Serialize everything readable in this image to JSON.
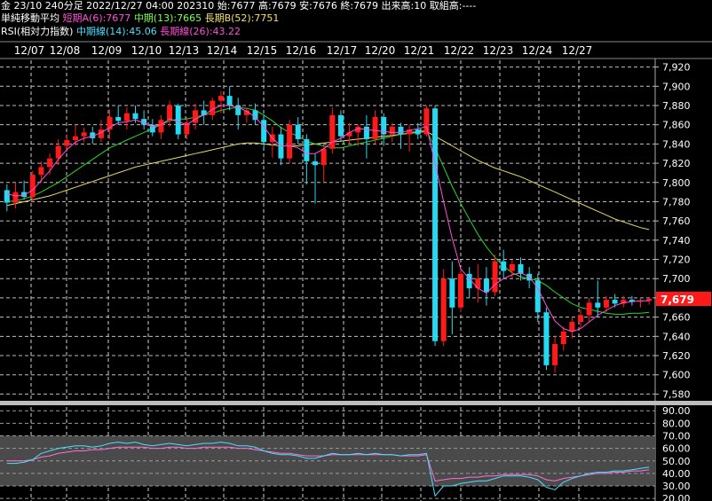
{
  "header": {
    "line1": "金 23/10 240分足 2022/12/27 04:00 202310 始:7677 高:7679 安:7676 終:7679 出来高:10 取組高:----",
    "line2_title": "単純移動平均",
    "line2_a": "短期A(6):7677",
    "line2_b": "中期(13):7665",
    "line2_c": "長期B(52):7751",
    "line3_title": "RSI(相対力指数)",
    "line3_a": "中期線(14):45.06",
    "line3_b": "長期線(26):43.22"
  },
  "colors": {
    "up": "#ff1a1a",
    "down": "#26d9f2",
    "ma_short": "#ff4fd8",
    "ma_mid": "#2bd52b",
    "ma_long": "#e8d86a",
    "rsi_mid": "#48e0ff",
    "rsi_long": "#ff6fd8",
    "price_badge": "#ff1a1a",
    "rsi_band": "#4a4a4a"
  },
  "chart_data": [
    {
      "type": "candlestick",
      "x_labels": [
        "12/07",
        "12/08",
        "12/09",
        "12/10",
        "12/13",
        "12/14",
        "12/15",
        "12/16",
        "12/17",
        "12/20",
        "12/21",
        "12/22",
        "12/23",
        "12/24",
        "12/27"
      ],
      "y_ticks": [
        7580,
        7600,
        7620,
        7640,
        7660,
        7680,
        7700,
        7720,
        7740,
        7760,
        7780,
        7800,
        7820,
        7840,
        7860,
        7880,
        7900,
        7920
      ],
      "ylim": [
        7573,
        7927
      ],
      "current_price": "7,679",
      "candles": [
        [
          7792,
          7798,
          7770,
          7779
        ],
        [
          7779,
          7800,
          7773,
          7790
        ],
        [
          7790,
          7802,
          7782,
          7785
        ],
        [
          7785,
          7812,
          7780,
          7808
        ],
        [
          7808,
          7822,
          7800,
          7816
        ],
        [
          7816,
          7830,
          7808,
          7825
        ],
        [
          7825,
          7845,
          7818,
          7838
        ],
        [
          7838,
          7850,
          7832,
          7844
        ],
        [
          7844,
          7860,
          7838,
          7848
        ],
        [
          7848,
          7857,
          7842,
          7852
        ],
        [
          7852,
          7858,
          7840,
          7846
        ],
        [
          7846,
          7865,
          7842,
          7855
        ],
        [
          7855,
          7876,
          7845,
          7868
        ],
        [
          7868,
          7880,
          7860,
          7864
        ],
        [
          7864,
          7878,
          7855,
          7872
        ],
        [
          7872,
          7880,
          7862,
          7866
        ],
        [
          7866,
          7875,
          7855,
          7860
        ],
        [
          7860,
          7866,
          7848,
          7852
        ],
        [
          7852,
          7870,
          7845,
          7865
        ],
        [
          7865,
          7885,
          7858,
          7880
        ],
        [
          7880,
          7882,
          7845,
          7850
        ],
        [
          7850,
          7868,
          7845,
          7862
        ],
        [
          7862,
          7882,
          7855,
          7875
        ],
        [
          7875,
          7885,
          7860,
          7870
        ],
        [
          7870,
          7888,
          7865,
          7885
        ],
        [
          7885,
          7895,
          7872,
          7890
        ],
        [
          7890,
          7900,
          7875,
          7880
        ],
        [
          7880,
          7888,
          7855,
          7870
        ],
        [
          7870,
          7878,
          7862,
          7875
        ],
        [
          7875,
          7882,
          7860,
          7865
        ],
        [
          7865,
          7870,
          7835,
          7842
        ],
        [
          7842,
          7858,
          7826,
          7850
        ],
        [
          7850,
          7858,
          7818,
          7825
        ],
        [
          7825,
          7865,
          7820,
          7860
        ],
        [
          7860,
          7868,
          7840,
          7845
        ],
        [
          7845,
          7850,
          7798,
          7822
        ],
        [
          7822,
          7830,
          7778,
          7818
        ],
        [
          7818,
          7840,
          7800,
          7835
        ],
        [
          7835,
          7878,
          7830,
          7870
        ],
        [
          7870,
          7875,
          7842,
          7848
        ],
        [
          7848,
          7862,
          7840,
          7852
        ],
        [
          7852,
          7860,
          7838,
          7858
        ],
        [
          7858,
          7870,
          7825,
          7845
        ],
        [
          7845,
          7875,
          7840,
          7868
        ],
        [
          7868,
          7872,
          7838,
          7850
        ],
        [
          7850,
          7862,
          7842,
          7858
        ],
        [
          7858,
          7862,
          7835,
          7850
        ],
        [
          7850,
          7860,
          7832,
          7855
        ],
        [
          7855,
          7862,
          7845,
          7850
        ],
        [
          7850,
          7880,
          7848,
          7877
        ],
        [
          7877,
          7880,
          7630,
          7635
        ],
        [
          7635,
          7710,
          7630,
          7700
        ],
        [
          7700,
          7718,
          7642,
          7670
        ],
        [
          7670,
          7712,
          7665,
          7705
        ],
        [
          7705,
          7712,
          7680,
          7690
        ],
        [
          7690,
          7715,
          7675,
          7700
        ],
        [
          7700,
          7712,
          7672,
          7686
        ],
        [
          7686,
          7725,
          7682,
          7718
        ],
        [
          7718,
          7730,
          7700,
          7708
        ],
        [
          7708,
          7720,
          7700,
          7715
        ],
        [
          7715,
          7722,
          7698,
          7705
        ],
        [
          7705,
          7712,
          7690,
          7698
        ],
        [
          7698,
          7705,
          7655,
          7665
        ],
        [
          7665,
          7670,
          7605,
          7610
        ],
        [
          7610,
          7640,
          7602,
          7632
        ],
        [
          7632,
          7650,
          7625,
          7645
        ],
        [
          7645,
          7660,
          7638,
          7655
        ],
        [
          7655,
          7668,
          7648,
          7662
        ],
        [
          7662,
          7680,
          7655,
          7675
        ],
        [
          7675,
          7698,
          7660,
          7670
        ],
        [
          7670,
          7682,
          7665,
          7678
        ],
        [
          7678,
          7684,
          7670,
          7674
        ],
        [
          7674,
          7682,
          7670,
          7678
        ],
        [
          7678,
          7682,
          7672,
          7676
        ],
        [
          7676,
          7680,
          7670,
          7677
        ],
        [
          7677,
          7681,
          7673,
          7679
        ]
      ],
      "ma_short": [
        7788,
        7786,
        7787,
        7792,
        7802,
        7812,
        7824,
        7834,
        7842,
        7846,
        7848,
        7852,
        7857,
        7862,
        7863,
        7865,
        7862,
        7858,
        7860,
        7866,
        7863,
        7860,
        7866,
        7870,
        7876,
        7880,
        7880,
        7878,
        7874,
        7868,
        7858,
        7846,
        7838,
        7838,
        7836,
        7830,
        7830,
        7835,
        7842,
        7846,
        7852,
        7856,
        7855,
        7854,
        7853,
        7852,
        7852,
        7854,
        7856,
        7858,
        7820,
        7780,
        7742,
        7710,
        7700,
        7690,
        7685,
        7694,
        7700,
        7704,
        7706,
        7702,
        7690,
        7672,
        7656,
        7648,
        7645,
        7648,
        7655,
        7662,
        7667,
        7672,
        7675,
        7676,
        7677,
        7677
      ],
      "ma_mid": [
        7780,
        7781,
        7783,
        7786,
        7790,
        7795,
        7800,
        7806,
        7812,
        7818,
        7824,
        7830,
        7836,
        7840,
        7844,
        7848,
        7852,
        7856,
        7860,
        7864,
        7866,
        7866,
        7868,
        7870,
        7872,
        7875,
        7877,
        7878,
        7877,
        7875,
        7870,
        7864,
        7857,
        7852,
        7848,
        7843,
        7840,
        7838,
        7836,
        7836,
        7838,
        7840,
        7842,
        7844,
        7846,
        7848,
        7850,
        7852,
        7853,
        7854,
        7836,
        7816,
        7796,
        7778,
        7762,
        7746,
        7733,
        7722,
        7713,
        7706,
        7702,
        7700,
        7698,
        7693,
        7686,
        7680,
        7674,
        7670,
        7668,
        7666,
        7664,
        7663,
        7663,
        7664,
        7664,
        7665
      ],
      "ma_long": [
        7776,
        7778,
        7780,
        7782,
        7784,
        7786,
        7789,
        7792,
        7795,
        7798,
        7801,
        7804,
        7807,
        7810,
        7813,
        7816,
        7818,
        7820,
        7822,
        7824,
        7826,
        7828,
        7830,
        7832,
        7834,
        7836,
        7838,
        7840,
        7841,
        7841,
        7840,
        7839,
        7838,
        7838,
        7838,
        7839,
        7840,
        7841,
        7842,
        7843,
        7844,
        7845,
        7846,
        7847,
        7848,
        7849,
        7850,
        7851,
        7852,
        7853,
        7848,
        7843,
        7838,
        7833,
        7828,
        7823,
        7819,
        7815,
        7812,
        7809,
        7806,
        7802,
        7798,
        7794,
        7790,
        7786,
        7782,
        7778,
        7774,
        7770,
        7766,
        7762,
        7759,
        7756,
        7753,
        7751
      ]
    },
    {
      "type": "line",
      "title": "RSI",
      "y_ticks": [
        20,
        30,
        40,
        50,
        60,
        70,
        80,
        90
      ],
      "tick_labels": [
        "20.00",
        "30.00",
        "40.00",
        "50.00",
        "60.00",
        "70.00",
        "80.00",
        "90.00"
      ],
      "ylim": [
        18,
        93
      ],
      "shaded_bands": [
        [
          30,
          50
        ],
        [
          50,
          70
        ]
      ],
      "rsi_mid": [
        48,
        48,
        49,
        51,
        56,
        58,
        60,
        61,
        62,
        62,
        61,
        62,
        64,
        65,
        64,
        65,
        63,
        62,
        63,
        64,
        63,
        62,
        63,
        64,
        64,
        65,
        64,
        62,
        62,
        61,
        58,
        56,
        55,
        55,
        54,
        52,
        52,
        54,
        56,
        55,
        55,
        56,
        55,
        56,
        55,
        55,
        54,
        55,
        55,
        56,
        22,
        30,
        30,
        32,
        33,
        34,
        34,
        36,
        38,
        38,
        38,
        37,
        35,
        29,
        27,
        33,
        36,
        38,
        40,
        41,
        41,
        42,
        42,
        43,
        44,
        45
      ],
      "rsi_long": [
        50,
        50,
        50,
        51,
        53,
        54,
        56,
        57,
        58,
        58,
        59,
        59,
        60,
        61,
        61,
        61,
        61,
        60,
        60,
        61,
        61,
        60,
        60,
        61,
        61,
        61,
        61,
        60,
        60,
        59,
        58,
        57,
        56,
        56,
        55,
        54,
        54,
        54,
        55,
        55,
        55,
        55,
        55,
        55,
        55,
        55,
        54,
        54,
        54,
        55,
        34,
        35,
        36,
        36,
        37,
        37,
        38,
        38,
        39,
        39,
        39,
        39,
        38,
        35,
        34,
        36,
        37,
        38,
        39,
        40,
        40,
        41,
        41,
        42,
        42,
        43
      ]
    }
  ]
}
